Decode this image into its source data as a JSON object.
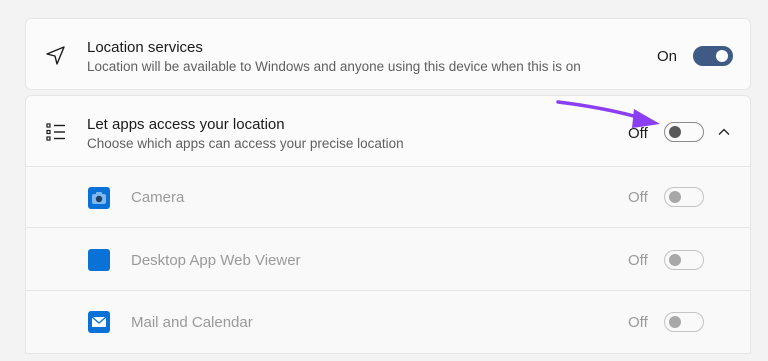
{
  "location_services": {
    "icon": "navigation-arrow-icon",
    "title": "Location services",
    "subtitle": "Location will be available to Windows and anyone using this device when this is on",
    "state": "On",
    "toggle_on": true
  },
  "apps_access": {
    "icon": "list-icon",
    "title": "Let apps access your location",
    "subtitle": "Choose which apps can access your precise location",
    "state": "Off",
    "toggle_on": false,
    "expand_icon": "chevron-up-icon"
  },
  "apps": [
    {
      "name": "Camera",
      "icon": "camera-app-icon",
      "state": "Off",
      "toggle_on": false
    },
    {
      "name": "Desktop App Web Viewer",
      "icon": "web-viewer-app-icon",
      "state": "Off",
      "toggle_on": false
    },
    {
      "name": "Mail and Calendar",
      "icon": "mail-app-icon",
      "state": "Off",
      "toggle_on": false
    }
  ],
  "annotation": {
    "icon": "purple-arrow-icon",
    "color": "#8b3ff2"
  },
  "colors": {
    "accent": "#3f5b85",
    "app_icon_blue": "#0a72d6",
    "background": "#f3f3f3"
  }
}
